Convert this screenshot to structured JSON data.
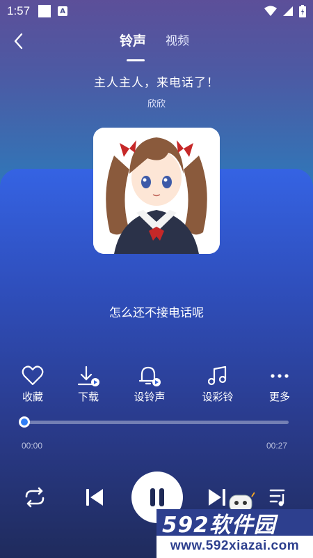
{
  "status_bar": {
    "time": "1:57",
    "a_icon": "A"
  },
  "header": {
    "tab_ringtone": "铃声",
    "tab_video": "视频"
  },
  "song": {
    "title": "主人主人，来电话了！",
    "artist": "欣欣"
  },
  "lyric": "怎么还不接电话呢",
  "actions": [
    {
      "label": "收藏",
      "icon": "heart-icon"
    },
    {
      "label": "下载",
      "icon": "download-icon"
    },
    {
      "label": "设铃声",
      "icon": "bell-icon"
    },
    {
      "label": "设彩铃",
      "icon": "music-note-icon"
    },
    {
      "label": "更多",
      "icon": "more-icon"
    }
  ],
  "player": {
    "current_time": "00:00",
    "total_time": "00:27",
    "progress": 0
  },
  "watermark": {
    "brand": "592软件园",
    "url": "www.592xiazai.com"
  },
  "colors": {
    "accent": "#2f7df6",
    "card": "#3563e3"
  }
}
